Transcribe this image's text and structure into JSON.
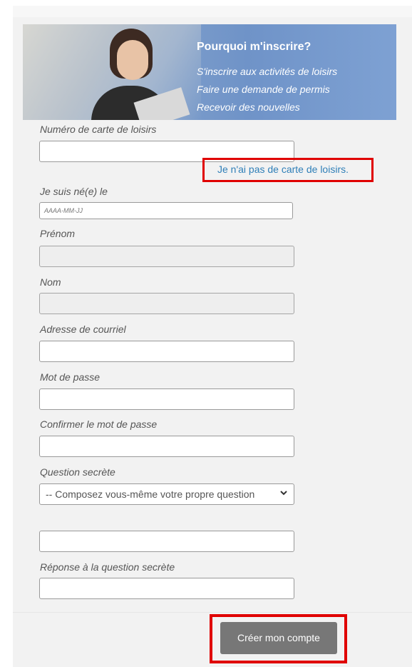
{
  "banner": {
    "title": "Pourquoi m'inscrire?",
    "lines": [
      "S'inscrire aux activités de loisirs",
      "Faire une demande de permis",
      "Recevoir des nouvelles"
    ]
  },
  "form": {
    "card_label": "Numéro de carte de loisirs",
    "no_card_link": "Je n'ai pas de carte de loisirs.",
    "birth_label": "Je suis né(e) le",
    "birth_placeholder": "AAAA-MM-JJ",
    "first_name_label": "Prénom",
    "last_name_label": "Nom",
    "email_label": "Adresse de courriel",
    "password_label": "Mot de passe",
    "confirm_password_label": "Confirmer le mot de passe",
    "question_label": "Question secrète",
    "question_selected": "-- Composez vous-même votre propre question",
    "answer_label": "Réponse à la question secrète",
    "submit_label": "Créer mon compte"
  },
  "colors": {
    "highlight": "#e00000",
    "link": "#2f7fb8",
    "button": "#777777",
    "panel": "#f2f2f2"
  },
  "icons": {
    "select_chevron": "chevron-down-icon"
  }
}
